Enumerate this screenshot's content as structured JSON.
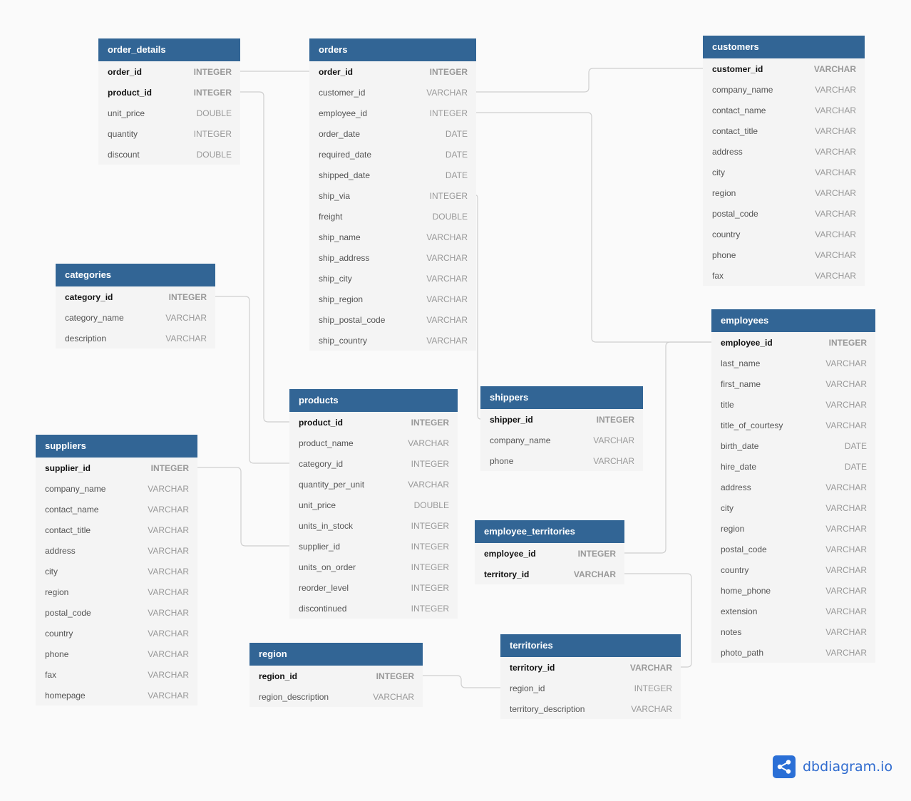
{
  "colors": {
    "header": "#326595",
    "connector": "#cfcfcf",
    "brand": "#2a6fd6"
  },
  "brand": {
    "name": "dbdiagram.io",
    "icon": "share-nodes-icon"
  },
  "tables": [
    {
      "name": "order_details",
      "fields": [
        [
          "order_id",
          "INTEGER",
          1
        ],
        [
          "product_id",
          "INTEGER",
          1
        ],
        [
          "unit_price",
          "DOUBLE",
          0
        ],
        [
          "quantity",
          "INTEGER",
          0
        ],
        [
          "discount",
          "DOUBLE",
          0
        ]
      ]
    },
    {
      "name": "orders",
      "fields": [
        [
          "order_id",
          "INTEGER",
          1
        ],
        [
          "customer_id",
          "VARCHAR",
          0
        ],
        [
          "employee_id",
          "INTEGER",
          0
        ],
        [
          "order_date",
          "DATE",
          0
        ],
        [
          "required_date",
          "DATE",
          0
        ],
        [
          "shipped_date",
          "DATE",
          0
        ],
        [
          "ship_via",
          "INTEGER",
          0
        ],
        [
          "freight",
          "DOUBLE",
          0
        ],
        [
          "ship_name",
          "VARCHAR",
          0
        ],
        [
          "ship_address",
          "VARCHAR",
          0
        ],
        [
          "ship_city",
          "VARCHAR",
          0
        ],
        [
          "ship_region",
          "VARCHAR",
          0
        ],
        [
          "ship_postal_code",
          "VARCHAR",
          0
        ],
        [
          "ship_country",
          "VARCHAR",
          0
        ]
      ]
    },
    {
      "name": "customers",
      "fields": [
        [
          "customer_id",
          "VARCHAR",
          1
        ],
        [
          "company_name",
          "VARCHAR",
          0
        ],
        [
          "contact_name",
          "VARCHAR",
          0
        ],
        [
          "contact_title",
          "VARCHAR",
          0
        ],
        [
          "address",
          "VARCHAR",
          0
        ],
        [
          "city",
          "VARCHAR",
          0
        ],
        [
          "region",
          "VARCHAR",
          0
        ],
        [
          "postal_code",
          "VARCHAR",
          0
        ],
        [
          "country",
          "VARCHAR",
          0
        ],
        [
          "phone",
          "VARCHAR",
          0
        ],
        [
          "fax",
          "VARCHAR",
          0
        ]
      ]
    },
    {
      "name": "categories",
      "fields": [
        [
          "category_id",
          "INTEGER",
          1
        ],
        [
          "category_name",
          "VARCHAR",
          0
        ],
        [
          "description",
          "VARCHAR",
          0
        ]
      ]
    },
    {
      "name": "products",
      "fields": [
        [
          "product_id",
          "INTEGER",
          1
        ],
        [
          "product_name",
          "VARCHAR",
          0
        ],
        [
          "category_id",
          "INTEGER",
          0
        ],
        [
          "quantity_per_unit",
          "VARCHAR",
          0
        ],
        [
          "unit_price",
          "DOUBLE",
          0
        ],
        [
          "units_in_stock",
          "INTEGER",
          0
        ],
        [
          "supplier_id",
          "INTEGER",
          0
        ],
        [
          "units_on_order",
          "INTEGER",
          0
        ],
        [
          "reorder_level",
          "INTEGER",
          0
        ],
        [
          "discontinued",
          "INTEGER",
          0
        ]
      ]
    },
    {
      "name": "shippers",
      "fields": [
        [
          "shipper_id",
          "INTEGER",
          1
        ],
        [
          "company_name",
          "VARCHAR",
          0
        ],
        [
          "phone",
          "VARCHAR",
          0
        ]
      ]
    },
    {
      "name": "suppliers",
      "fields": [
        [
          "supplier_id",
          "INTEGER",
          1
        ],
        [
          "company_name",
          "VARCHAR",
          0
        ],
        [
          "contact_name",
          "VARCHAR",
          0
        ],
        [
          "contact_title",
          "VARCHAR",
          0
        ],
        [
          "address",
          "VARCHAR",
          0
        ],
        [
          "city",
          "VARCHAR",
          0
        ],
        [
          "region",
          "VARCHAR",
          0
        ],
        [
          "postal_code",
          "VARCHAR",
          0
        ],
        [
          "country",
          "VARCHAR",
          0
        ],
        [
          "phone",
          "VARCHAR",
          0
        ],
        [
          "fax",
          "VARCHAR",
          0
        ],
        [
          "homepage",
          "VARCHAR",
          0
        ]
      ]
    },
    {
      "name": "employees",
      "fields": [
        [
          "employee_id",
          "INTEGER",
          1
        ],
        [
          "last_name",
          "VARCHAR",
          0
        ],
        [
          "first_name",
          "VARCHAR",
          0
        ],
        [
          "title",
          "VARCHAR",
          0
        ],
        [
          "title_of_courtesy",
          "VARCHAR",
          0
        ],
        [
          "birth_date",
          "DATE",
          0
        ],
        [
          "hire_date",
          "DATE",
          0
        ],
        [
          "address",
          "VARCHAR",
          0
        ],
        [
          "city",
          "VARCHAR",
          0
        ],
        [
          "region",
          "VARCHAR",
          0
        ],
        [
          "postal_code",
          "VARCHAR",
          0
        ],
        [
          "country",
          "VARCHAR",
          0
        ],
        [
          "home_phone",
          "VARCHAR",
          0
        ],
        [
          "extension",
          "VARCHAR",
          0
        ],
        [
          "notes",
          "VARCHAR",
          0
        ],
        [
          "photo_path",
          "VARCHAR",
          0
        ]
      ]
    },
    {
      "name": "employee_territories",
      "fields": [
        [
          "employee_id",
          "INTEGER",
          1
        ],
        [
          "territory_id",
          "VARCHAR",
          1
        ]
      ]
    },
    {
      "name": "region",
      "fields": [
        [
          "region_id",
          "INTEGER",
          1
        ],
        [
          "region_description",
          "VARCHAR",
          0
        ]
      ]
    },
    {
      "name": "territories",
      "fields": [
        [
          "territory_id",
          "VARCHAR",
          1
        ],
        [
          "region_id",
          "INTEGER",
          0
        ],
        [
          "territory_description",
          "VARCHAR",
          0
        ]
      ]
    }
  ],
  "relationships": [
    [
      "order_details.order_id",
      "orders.order_id"
    ],
    [
      "order_details.product_id",
      "products.product_id"
    ],
    [
      "orders.customer_id",
      "customers.customer_id"
    ],
    [
      "orders.employee_id",
      "employees.employee_id"
    ],
    [
      "orders.ship_via",
      "shippers.shipper_id"
    ],
    [
      "products.category_id",
      "categories.category_id"
    ],
    [
      "products.supplier_id",
      "suppliers.supplier_id"
    ],
    [
      "employee_territories.employee_id",
      "employees.employee_id"
    ],
    [
      "employee_territories.territory_id",
      "territories.territory_id"
    ],
    [
      "territories.region_id",
      "region.region_id"
    ]
  ]
}
